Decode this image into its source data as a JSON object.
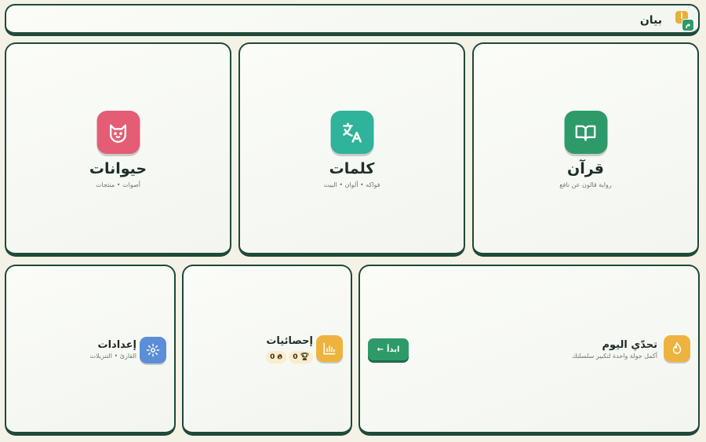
{
  "header": {
    "app_title": "بيان",
    "logo_letter_top": "أ",
    "logo_letter_bottom": "م"
  },
  "tiles": [
    {
      "key": "quran",
      "title": "قرآن",
      "subtitle": "رواية قالون عن نافع",
      "color": "#2e9a6a",
      "icon": "open-book-icon"
    },
    {
      "key": "words",
      "title": "كلمات",
      "subtitle": "فواكه • ألوان • البيت",
      "color": "#2fb39a",
      "icon": "translate-icon"
    },
    {
      "key": "animals",
      "title": "حيوانات",
      "subtitle": "أصوات • منتجات",
      "color": "#e45d74",
      "icon": "cat-face-icon"
    }
  ],
  "daily": {
    "title": "تحدّي اليوم",
    "subtitle": "أكمل جولة واحدة لتكبير سلسلتك",
    "start_label": "ابدأ",
    "color": "#eeb33e",
    "icon": "flame-icon"
  },
  "stats": {
    "title": "إحصائيات",
    "trophy_count": "0",
    "streak_count": "0",
    "color": "#eeb33e",
    "icon": "bar-chart-icon"
  },
  "settings": {
    "title": "إعدادات",
    "subtitle": "القارئ • التنزيلات",
    "color": "#5b8ed6",
    "icon": "gear-icon"
  }
}
